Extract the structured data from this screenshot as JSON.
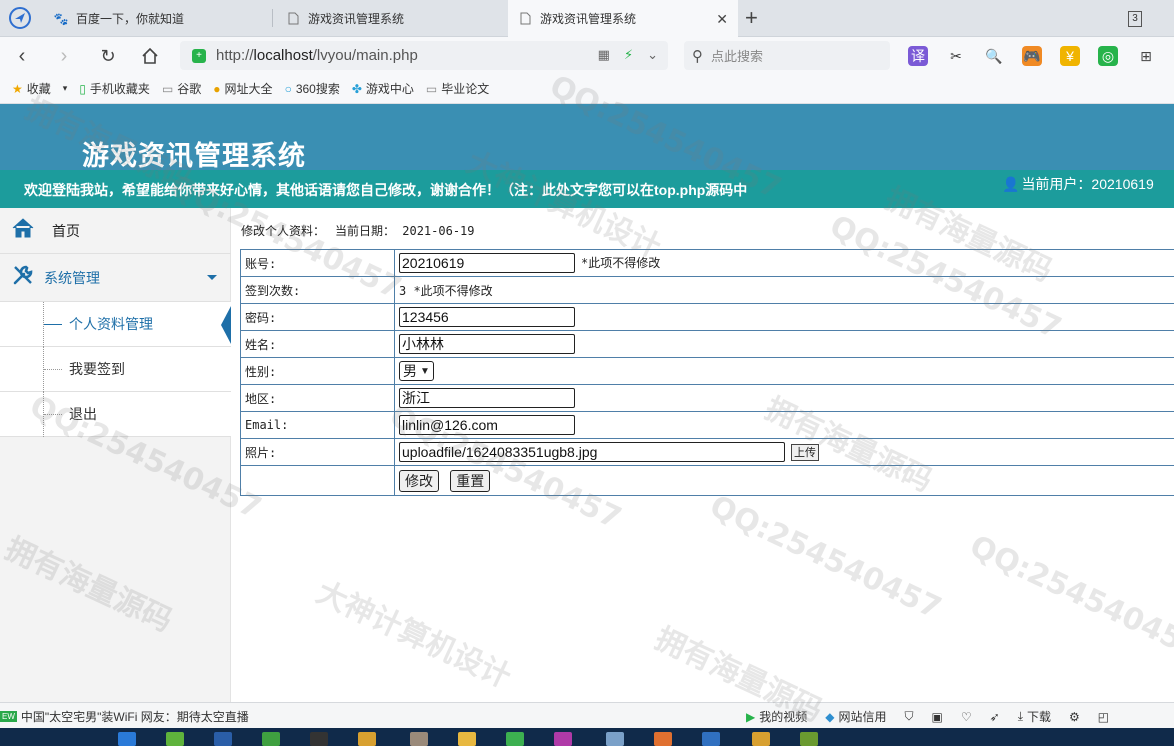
{
  "browser": {
    "tabs": [
      {
        "label": "百度一下，你就知道",
        "icon": "baidu-paw-icon"
      },
      {
        "label": "游戏资讯管理系统",
        "icon": "page-icon"
      },
      {
        "label": "游戏资讯管理系统",
        "icon": "page-icon",
        "active": true
      }
    ],
    "tab_count": "3",
    "url_prefix": "http://",
    "url_host": "localhost",
    "url_path": "/lvyou/main.php",
    "search_placeholder": "点此搜索",
    "translate_label": "译",
    "bookmarks": [
      {
        "label": "收藏",
        "icon": "star-icon"
      },
      {
        "label": "手机收藏夹",
        "icon": "phone-icon"
      },
      {
        "label": "谷歌",
        "icon": "page-icon"
      },
      {
        "label": "网址大全",
        "icon": "globe-icon"
      },
      {
        "label": "360搜索",
        "icon": "search-icon"
      },
      {
        "label": "游戏中心",
        "icon": "game-icon"
      },
      {
        "label": "毕业论文",
        "icon": "page-icon"
      }
    ]
  },
  "header": {
    "title": "游戏资讯管理系统",
    "marquee": "欢迎登陆我站，希望能给你带来好心情，其他话语请您自己修改，谢谢合作！（注：此处文字您可以在top.php源码中",
    "current_user": "当前用户：20210619"
  },
  "sidebar": {
    "home": "首页",
    "system": "系统管理",
    "sub_items": [
      "个人资料管理",
      "我要签到",
      "退出"
    ]
  },
  "main": {
    "crumb_title": "修改个人资料：",
    "crumb_date": "当前日期： 2021-06-19",
    "form": {
      "account_label": "账号:",
      "account_value": "20210619",
      "account_note": "*此项不得修改",
      "signin_label": "签到次数:",
      "signin_value": "3 *此项不得修改",
      "password_label": "密码:",
      "password_value": "123456",
      "name_label": "姓名:",
      "name_value": "小林林",
      "gender_label": "性别:",
      "gender_value": "男",
      "region_label": "地区:",
      "region_value": "浙江",
      "email_label": "Email:",
      "email_value": "linlin@126.com",
      "photo_label": "照片:",
      "photo_value": "uploadfile/1624083351ugb8.jpg",
      "upload_label": "上传",
      "submit_label": "修改",
      "reset_label": "重置"
    }
  },
  "statusbar": {
    "news_badge": "EW",
    "news": "中国\"太空宅男\"装WiFi 网友：期待太空直播",
    "items": [
      "我的视频",
      "网站信用",
      "下载"
    ]
  },
  "watermarks": [
    "拥有海量源码",
    "QQ:254540457",
    "大神计算机设计"
  ]
}
